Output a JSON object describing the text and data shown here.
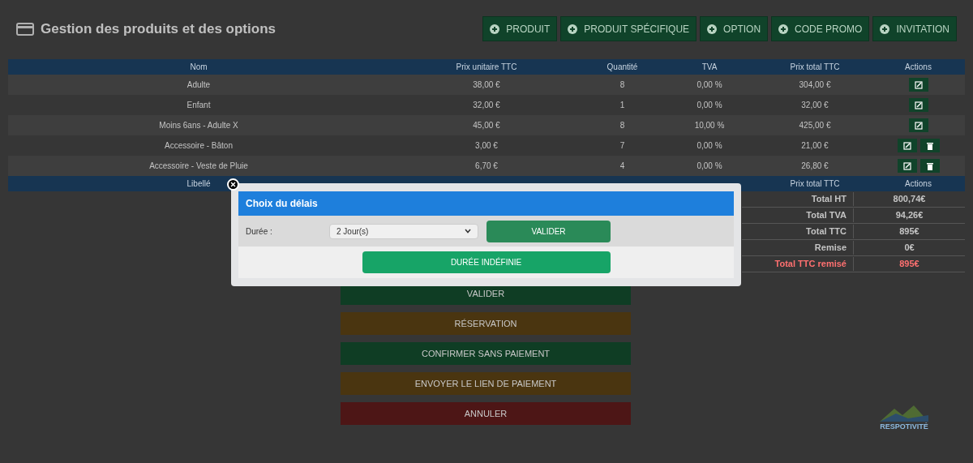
{
  "page": {
    "title": "Gestion des produits et des options"
  },
  "toolbar": [
    "PRODUIT",
    "PRODUIT SPÉCIFIQUE",
    "OPTION",
    "CODE PROMO",
    "INVITATION"
  ],
  "products": {
    "columns": [
      "Nom",
      "Prix unitaire TTC",
      "Quantité",
      "TVA",
      "Prix total TTC",
      "Actions"
    ],
    "rows": [
      {
        "cells": [
          "Adulte",
          "38,00 €",
          "8",
          "0,00 %",
          "304,00 €"
        ],
        "deletable": false
      },
      {
        "cells": [
          "Enfant",
          "32,00 €",
          "1",
          "0,00 %",
          "32,00 €"
        ],
        "deletable": false
      },
      {
        "cells": [
          "Moins 6ans - Adulte X",
          "45,00 €",
          "8",
          "10,00 %",
          "425,00 €"
        ],
        "deletable": false
      },
      {
        "cells": [
          "Accessoire - Bâton",
          "3,00 €",
          "7",
          "0,00 %",
          "21,00 €"
        ],
        "deletable": true
      },
      {
        "cells": [
          "Accessoire - Veste de Pluie",
          "6,70 €",
          "4",
          "0,00 %",
          "26,80 €"
        ],
        "deletable": true
      }
    ]
  },
  "totals": {
    "columns": [
      "Libellé",
      "Prix total TTC",
      "Actions"
    ],
    "rows": [
      {
        "label": "Total HT",
        "value": "800,74€",
        "highlight": false
      },
      {
        "label": "Total TVA",
        "value": "94,26€",
        "highlight": false
      },
      {
        "label": "Total TTC",
        "value": "895€",
        "highlight": false
      },
      {
        "label": "Remise",
        "value": "0€",
        "highlight": false
      },
      {
        "label": "Total TTC remisé",
        "value": "895€",
        "highlight": true
      }
    ]
  },
  "actions": [
    {
      "label": "VALIDER",
      "kind": "success"
    },
    {
      "label": "RÉSERVATION",
      "kind": "warning"
    },
    {
      "label": "CONFIRMER SANS PAIEMENT",
      "kind": "success"
    },
    {
      "label": "ENVOYER LE LIEN DE PAIEMENT",
      "kind": "warning"
    },
    {
      "label": "ANNULER",
      "kind": "danger"
    }
  ],
  "logo": {
    "text": "RESPOTIVITÉ"
  },
  "modal": {
    "title": "Choix du délais",
    "field_label": "Durée :",
    "select_value": "2 Jour(s)",
    "submit": "VALIDER",
    "secondary": "DURÉE INDÉFINIE"
  }
}
